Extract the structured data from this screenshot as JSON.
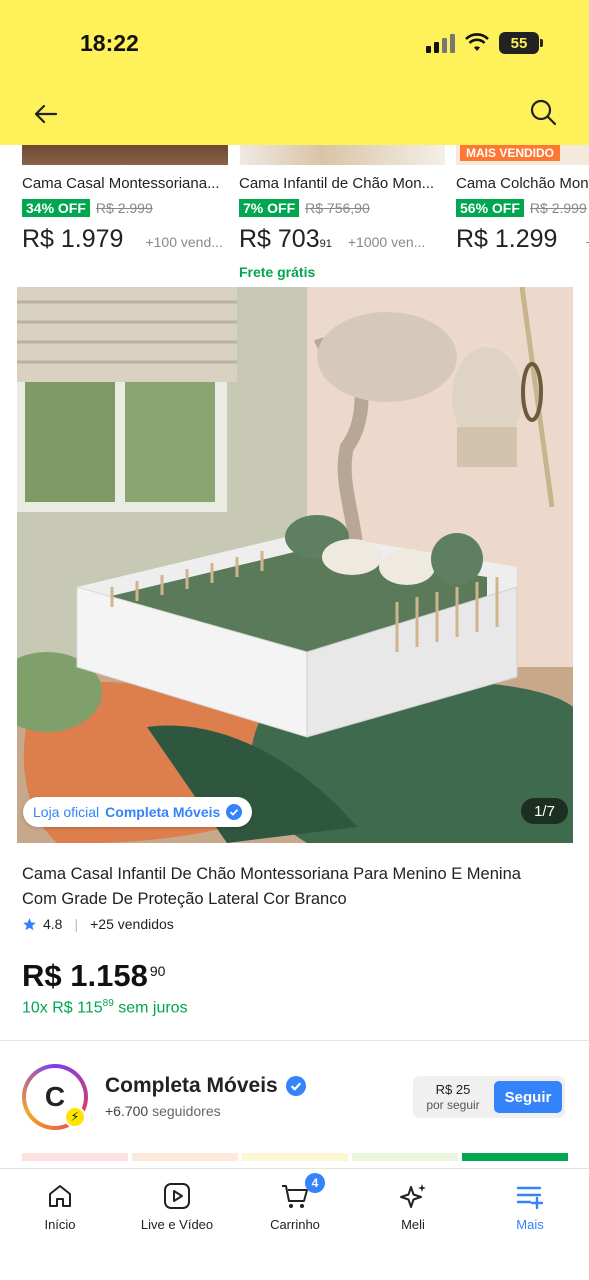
{
  "status_bar": {
    "time": "18:22",
    "battery": "55"
  },
  "header": {
    "back_icon": "arrow-left-icon",
    "search_icon": "search-icon",
    "background": "#fff159"
  },
  "related": {
    "badge_label": "MAIS VENDIDO",
    "items": [
      {
        "title": "Cama Casal Montessoriana...",
        "discount": "34% OFF",
        "old_price": "R$ 2.999",
        "price": "R$ 1.979",
        "price_cents": "",
        "sold": "+100 vend...",
        "shipping": ""
      },
      {
        "title": "Cama Infantil de Chão Mon...",
        "discount": "7% OFF",
        "old_price": "R$ 756,90",
        "price": "R$ 703",
        "price_cents": "91",
        "sold": "+1000 ven...",
        "shipping": "Frete grátis"
      },
      {
        "title": "Cama Colchão Mont",
        "discount": "56% OFF",
        "old_price": "R$ 2.999",
        "price": "R$ 1.299",
        "price_cents": "",
        "sold": "+",
        "shipping": ""
      }
    ]
  },
  "gallery": {
    "official_prefix": "Loja oficial",
    "official_store": "Completa Móveis",
    "counter": "1/7"
  },
  "product": {
    "title": "Cama Casal Infantil De Chão Montessoriana Para Menino E Menina Com Grade De Proteção Lateral Cor Branco",
    "rating": "4.8",
    "sold": "+25 vendidos",
    "price": "R$ 1.158",
    "price_cents": "90",
    "installments_prefix": "10x R$ 115",
    "installments_cents": "89",
    "installments_suffix": " sem juros"
  },
  "seller": {
    "logo_letter": "C",
    "name": "Completa Móveis",
    "followers": "+6.700",
    "followers_label": "seguidores",
    "coupon_amount": "R$ 25",
    "coupon_label": "por seguir",
    "follow_label": "Seguir"
  },
  "tabbar": {
    "items": [
      {
        "label": "Início",
        "icon": "home-icon"
      },
      {
        "label": "Live e Vídeo",
        "icon": "play-icon"
      },
      {
        "label": "Carrinho",
        "icon": "cart-icon",
        "badge": "4"
      },
      {
        "label": "Meli",
        "icon": "sparkle-icon"
      },
      {
        "label": "Mais",
        "icon": "menu-add-icon",
        "active": true
      }
    ]
  },
  "colors": {
    "accent": "#3483fa",
    "green": "#00a650",
    "yellow": "#fff159"
  }
}
